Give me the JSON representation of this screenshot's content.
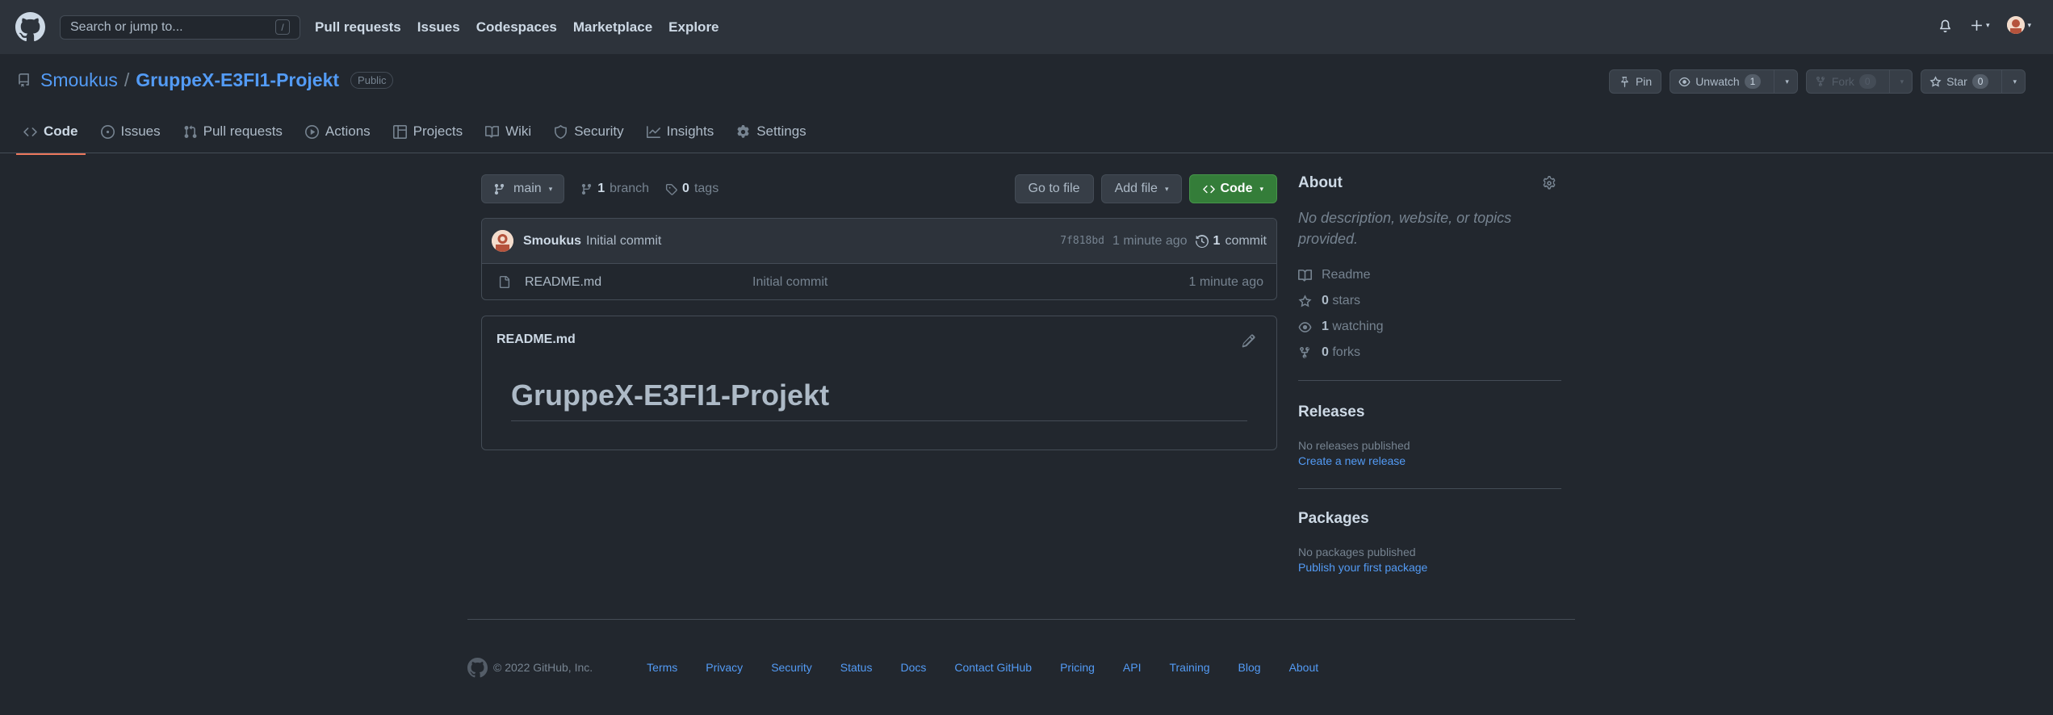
{
  "header": {
    "search_placeholder": "Search or jump to...",
    "search_key": "/",
    "nav": [
      "Pull requests",
      "Issues",
      "Codespaces",
      "Marketplace",
      "Explore"
    ]
  },
  "repo": {
    "owner": "Smoukus",
    "separator": "/",
    "name": "GruppeX-E3FI1-Projekt",
    "visibility": "Public",
    "pin_label": "Pin",
    "unwatch_label": "Unwatch",
    "watch_count": "1",
    "fork_label": "Fork",
    "fork_count": "0",
    "star_label": "Star",
    "star_count": "0"
  },
  "tabs": [
    {
      "label": "Code",
      "icon": "code-icon",
      "active": true
    },
    {
      "label": "Issues",
      "icon": "issue-icon"
    },
    {
      "label": "Pull requests",
      "icon": "pull-request-icon"
    },
    {
      "label": "Actions",
      "icon": "play-icon"
    },
    {
      "label": "Projects",
      "icon": "table-icon"
    },
    {
      "label": "Wiki",
      "icon": "book-icon"
    },
    {
      "label": "Security",
      "icon": "shield-icon"
    },
    {
      "label": "Insights",
      "icon": "graph-icon"
    },
    {
      "label": "Settings",
      "icon": "gear-icon"
    }
  ],
  "branchbar": {
    "branch": "main",
    "branch_count": "1",
    "branch_word": "branch",
    "tag_count": "0",
    "tag_word": "tags",
    "go_to_file": "Go to file",
    "add_file": "Add file",
    "code": "Code"
  },
  "latest_commit": {
    "author": "Smoukus",
    "message": "Initial commit",
    "sha": "7f818bd",
    "age": "1 minute ago",
    "commit_count": "1",
    "commit_word": "commit"
  },
  "files": [
    {
      "name": "README.md",
      "message": "Initial commit",
      "age": "1 minute ago"
    }
  ],
  "readme": {
    "title": "README.md",
    "heading": "GruppeX-E3FI1-Projekt"
  },
  "about": {
    "title": "About",
    "description": "No description, website, or topics provided.",
    "readme_label": "Readme",
    "stars_count": "0",
    "stars_word": "stars",
    "watching_count": "1",
    "watching_word": "watching",
    "forks_count": "0",
    "forks_word": "forks"
  },
  "releases": {
    "title": "Releases",
    "empty": "No releases published",
    "link": "Create a new release"
  },
  "packages": {
    "title": "Packages",
    "empty": "No packages published",
    "link": "Publish your first package"
  },
  "footer": {
    "copyright": "© 2022 GitHub, Inc.",
    "links": [
      "Terms",
      "Privacy",
      "Security",
      "Status",
      "Docs",
      "Contact GitHub",
      "Pricing",
      "API",
      "Training",
      "Blog",
      "About"
    ]
  },
  "colors": {
    "background": "#22272e",
    "header": "#2d333b",
    "accent_link": "#539bf5",
    "code_button": "#347d39",
    "active_tab_underline": "#ec775c"
  }
}
